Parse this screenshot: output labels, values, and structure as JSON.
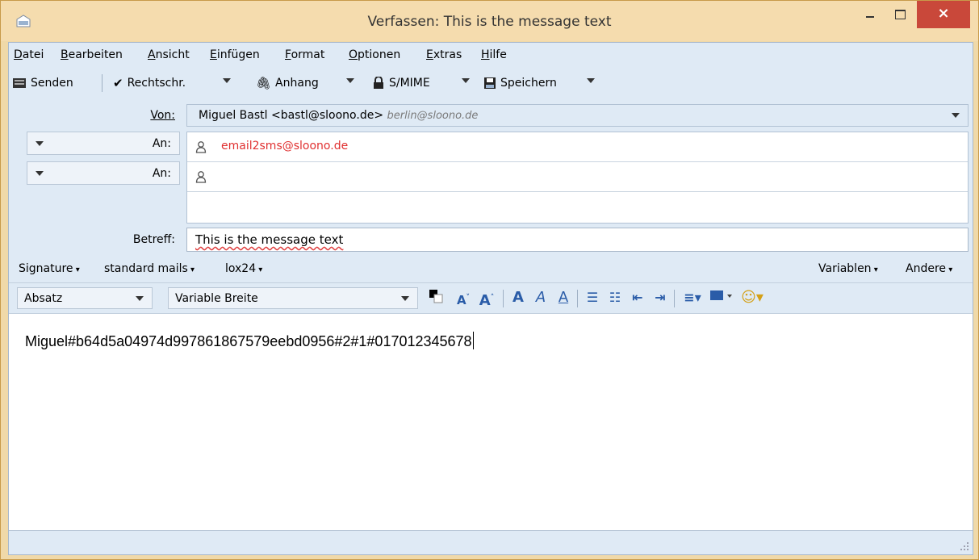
{
  "window": {
    "title": "Verfassen: This is the message text",
    "close_label": "×"
  },
  "menu": [
    "Datei",
    "Bearbeiten",
    "Ansicht",
    "Einfügen",
    "Format",
    "Optionen",
    "Extras",
    "Hilfe"
  ],
  "toolbar": {
    "send": "Senden",
    "spell": "Rechtschr.",
    "attach": "Anhang",
    "smime": "S/MIME",
    "save": "Speichern"
  },
  "header": {
    "from_label": "Von:",
    "from_value": "Miguel Bastl <bastl@sloono.de>",
    "from_alias": "berlin@sloono.de",
    "recipients": [
      {
        "label": "An:",
        "address": "email2sms@sloono.de"
      },
      {
        "label": "An:",
        "address": ""
      }
    ],
    "subject_label": "Betreff:",
    "subject_value": "This is the message text"
  },
  "signature_bar": {
    "left": [
      "Signature",
      "standard mails",
      "lox24"
    ],
    "right": [
      "Variablen",
      "Andere"
    ]
  },
  "format_bar": {
    "paragraph": "Absatz",
    "font": "Variable Breite"
  },
  "body_text": "Miguel#b64d5a04974d997861867579eebd0956#2#1#017012345678",
  "colors": {
    "titlebar": "#f5dcae",
    "close_button": "#c9483a",
    "client_bg": "#dfeaf5",
    "recipient_text": "#e03030"
  }
}
